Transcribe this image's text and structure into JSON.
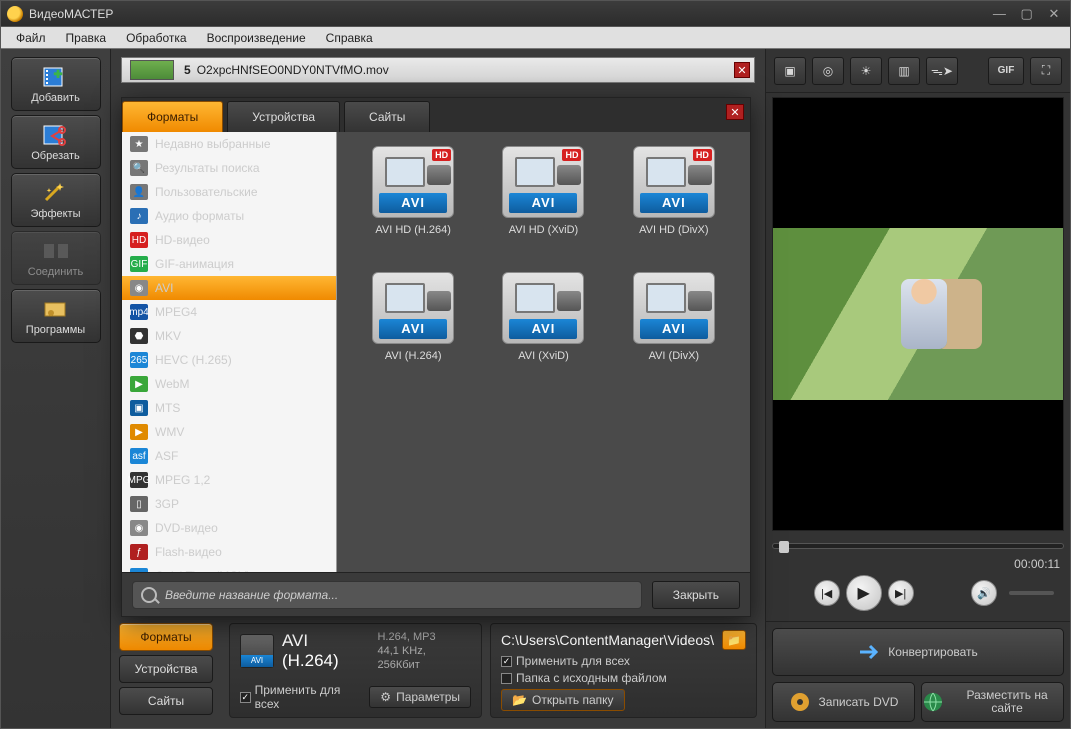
{
  "app_title": "ВидеоМАСТЕР",
  "menu": [
    "Файл",
    "Правка",
    "Обработка",
    "Воспроизведение",
    "Справка"
  ],
  "sidebar": [
    {
      "label": "Добавить",
      "icon": "film-plus"
    },
    {
      "label": "Обрезать",
      "icon": "film-scissors"
    },
    {
      "label": "Эффекты",
      "icon": "wand"
    },
    {
      "label": "Соединить",
      "icon": "merge",
      "disabled": true
    },
    {
      "label": "Программы",
      "icon": "programs"
    }
  ],
  "file_row": {
    "index": "5",
    "name": "O2xpcHNfSEO0NDY0NTVfMO.mov"
  },
  "popup": {
    "tabs": [
      "Форматы",
      "Устройства",
      "Сайты"
    ],
    "categories": [
      {
        "label": "Недавно выбранные",
        "ic": "★",
        "bg": "#777"
      },
      {
        "label": "Результаты поиска",
        "ic": "🔍",
        "bg": "#777"
      },
      {
        "label": "Пользовательские",
        "ic": "👤",
        "bg": "#777"
      },
      {
        "label": "Аудио форматы",
        "ic": "♪",
        "bg": "#2a6fb5"
      },
      {
        "label": "HD-видео",
        "ic": "HD",
        "bg": "#d62020"
      },
      {
        "label": "GIF-анимация",
        "ic": "GIF",
        "bg": "#25ad4b"
      },
      {
        "label": "AVI",
        "ic": "◉",
        "bg": "#888",
        "sel": true
      },
      {
        "label": "MPEG4",
        "ic": "mp4",
        "bg": "#1354a5"
      },
      {
        "label": "MKV",
        "ic": "⬣",
        "bg": "#333"
      },
      {
        "label": "HEVC (H.265)",
        "ic": "265",
        "bg": "#1b86d6"
      },
      {
        "label": "WebM",
        "ic": "▶",
        "bg": "#3aa73a"
      },
      {
        "label": "MTS",
        "ic": "▣",
        "bg": "#0e5c9e"
      },
      {
        "label": "WMV",
        "ic": "▶",
        "bg": "#e08a00"
      },
      {
        "label": "ASF",
        "ic": "asf",
        "bg": "#1b86d6"
      },
      {
        "label": "MPEG 1,2",
        "ic": "MPG",
        "bg": "#333"
      },
      {
        "label": "3GP",
        "ic": "▯",
        "bg": "#666"
      },
      {
        "label": "DVD-видео",
        "ic": "◉",
        "bg": "#888"
      },
      {
        "label": "Flash-видео",
        "ic": "ƒ",
        "bg": "#b02020"
      },
      {
        "label": "QuickTime (MOV)",
        "ic": "Q",
        "bg": "#1b86d6"
      }
    ],
    "formats": [
      {
        "label": "AVI HD (H.264)",
        "bar": "AVI",
        "hd": true
      },
      {
        "label": "AVI HD (XviD)",
        "bar": "AVI",
        "hd": true
      },
      {
        "label": "AVI HD (DivX)",
        "bar": "AVI",
        "hd": true
      },
      {
        "label": "AVI (H.264)",
        "bar": "AVI",
        "hd": false
      },
      {
        "label": "AVI (XviD)",
        "bar": "AVI",
        "hd": false
      },
      {
        "label": "AVI (DivX)",
        "bar": "AVI",
        "hd": false
      }
    ],
    "search_placeholder": "Введите название формата...",
    "close_btn": "Закрыть"
  },
  "bottom": {
    "tabs": [
      "Форматы",
      "Устройства",
      "Сайты"
    ],
    "preset_title": "AVI (H.264)",
    "preset_bar": "AVI",
    "codec_line1": "H.264, MP3",
    "codec_line2": "44,1 KHz, 256Кбит",
    "apply_all": "Применить для всех",
    "params_btn": "Параметры",
    "output_path": "C:\\Users\\ContentManager\\Videos\\",
    "apply_all2": "Применить для всех",
    "same_folder": "Папка с исходным файлом",
    "open_folder": "Открыть папку"
  },
  "right_tools": [
    "crop",
    "rotate",
    "brightness",
    "frame",
    "speed",
    "gif",
    "fullscreen"
  ],
  "gif_label": "GIF",
  "playback": {
    "time": "00:00:11"
  },
  "actions": {
    "convert": "Конвертировать",
    "burn": "Записать DVD",
    "upload": "Разместить на сайте"
  }
}
